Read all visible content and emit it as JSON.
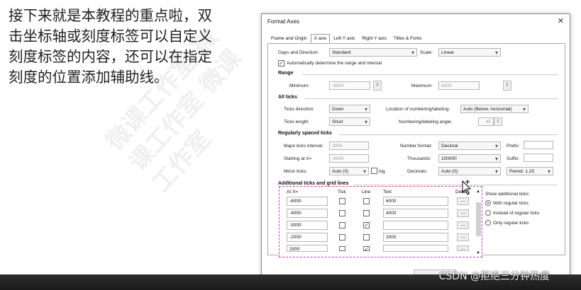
{
  "slide": {
    "lines": [
      "接下来就是本教程的重点啦，双",
      "击坐标轴或刻度标签可以自定义",
      "刻度标签的内容，还可以在指定",
      "刻度的位置添加辅助线。"
    ],
    "watermark": "微课工作室 微课工作室 微课工作室"
  },
  "csdn_watermark": "CSDN @拒绝三分钟热度",
  "dialog": {
    "title": "Format Axes",
    "tabs": [
      "Frame and Origin",
      "X axis",
      "Left Y axis",
      "Right Y axis",
      "Titles & Fonts"
    ],
    "active_tab": "X axis",
    "gaps": {
      "label": "Gaps and Direction:",
      "value": "Standard"
    },
    "scale": {
      "label": "Scale:",
      "value": "Linear"
    },
    "auto_range": {
      "label": "Automatically determine the range and interval",
      "checked": true
    },
    "range": {
      "heading": "Range",
      "min_label": "Minimum:",
      "min_value": "-6000",
      "max_label": "Maximum:",
      "max_value": "6000"
    },
    "all_ticks": {
      "heading": "All ticks",
      "direction_label": "Ticks direction:",
      "direction_value": "Down",
      "location_label": "Location of numbering/labeling:",
      "location_value": "Auto (Below, horizontal)",
      "length_label": "Ticks length:",
      "length_value": "Short",
      "angle_label": "Numbering/labeling angle:",
      "angle_value": "45"
    },
    "regular": {
      "heading": "Regularly spaced ticks",
      "major_label": "Major ticks interval:",
      "major_value": "2000",
      "format_label": "Number format:",
      "format_value": "Decimal",
      "prefix_label": "Prefix:",
      "prefix_value": "",
      "start_label": "Starting at X=",
      "start_value": "-6000",
      "thousands_label": "Thousands:",
      "thousands_value": "100000",
      "suffix_label": "Suffix:",
      "suffix_value": "",
      "minor_label": "Minor ticks:",
      "minor_value": "Auto (0)",
      "log_label": "log",
      "decimals_label": "Decimals:",
      "decimals_value": "Auto (0)",
      "period_value": "Period: 1.23"
    },
    "additional": {
      "heading": "Additional ticks and grid lines",
      "columns": [
        "At X=",
        "Tick",
        "Line",
        "Text",
        "Details"
      ],
      "rows": [
        {
          "at": "-6000",
          "tick": false,
          "line": false,
          "text": "6000"
        },
        {
          "at": "-4000",
          "tick": false,
          "line": false,
          "text": "4000"
        },
        {
          "at": "-3000",
          "tick": false,
          "line": true,
          "text": ""
        },
        {
          "at": "-2000",
          "tick": false,
          "line": false,
          "text": "2000"
        },
        {
          "at": "2000",
          "tick": false,
          "line": true,
          "text": ""
        }
      ],
      "details_btn": "...",
      "show_label": "Show additional ticks:",
      "options": [
        "With regular ticks",
        "Instead of regular ticks",
        "Only regular ticks"
      ],
      "selected_option": 0
    }
  }
}
